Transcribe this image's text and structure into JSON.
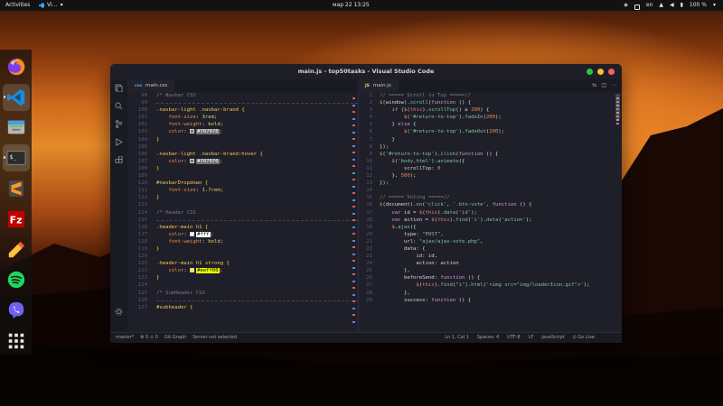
{
  "topbar": {
    "activities": "Activities",
    "app_name": "Vi…",
    "clock": "мар 22  13:25",
    "lang": "en",
    "battery": "100 %"
  },
  "dock": {
    "items": [
      {
        "name": "firefox-icon",
        "active": false
      },
      {
        "name": "vscode-icon",
        "active": true
      },
      {
        "name": "files-icon",
        "active": false
      },
      {
        "name": "terminal-icon",
        "active": true
      },
      {
        "name": "sublime-text-icon",
        "active": false
      },
      {
        "name": "filezilla-icon",
        "active": false
      },
      {
        "name": "color-picker-icon",
        "active": false
      },
      {
        "name": "spotify-icon",
        "active": false
      },
      {
        "name": "viber-icon",
        "active": false
      },
      {
        "name": "show-apps-icon",
        "active": false
      }
    ]
  },
  "window": {
    "title": "main.js - top50tasks - Visual Studio Code",
    "left_tab": "main.css",
    "right_tab": "main.js",
    "left_tab_icon": "css",
    "right_tab_icon": "JS"
  },
  "left_editor": {
    "lines": [
      {
        "n": "98",
        "html": "<span class='t-cm'>/* Navbar CSS</span>",
        "sep": false
      },
      {
        "n": "99",
        "html": "",
        "sep": true
      },
      {
        "n": "100",
        "html": "<span class='t-sel'>.navbar-light .navbar-brand</span> <span class='t-br'>{</span>"
      },
      {
        "n": "101",
        "html": "    <span class='t-prop'>font-size</span><span class='t-pl'>: </span><span class='t-val'>3rem</span><span class='t-pl'>;</span>"
      },
      {
        "n": "102",
        "html": "    <span class='t-prop'>font-weight</span><span class='t-pl'>: </span><span class='t-val'>bold</span><span class='t-pl'>;</span>"
      },
      {
        "n": "103",
        "html": "    <span class='t-prop'>color</span><span class='t-pl'>: </span><span class='swatch' style='background:#707070'></span><span class='hl' style='background:#707070;color:#fff'>#707070</span><span class='t-pl'>;</span>"
      },
      {
        "n": "104",
        "html": "<span class='t-br'>}</span>"
      },
      {
        "n": "105",
        "html": ""
      },
      {
        "n": "106",
        "html": "<span class='t-sel'>.navbar-light .navbar-brand:hover</span> <span class='t-br'>{</span>"
      },
      {
        "n": "107",
        "html": "    <span class='t-prop'>color</span><span class='t-pl'>: </span><span class='swatch' style='background:#707070'></span><span class='hl' style='background:#707070;color:#fff'>#707070</span><span class='t-pl'>;</span>"
      },
      {
        "n": "108",
        "html": "<span class='t-br'>}</span>"
      },
      {
        "n": "109",
        "html": ""
      },
      {
        "n": "110",
        "html": "<span class='t-sel'>#navbarDropdown</span> <span class='t-br'>{</span>"
      },
      {
        "n": "111",
        "html": "    <span class='t-prop'>font-size</span><span class='t-pl'>: </span><span class='t-val'>1.7rem</span><span class='t-pl'>;</span>"
      },
      {
        "n": "112",
        "html": "<span class='t-br'>}</span>"
      },
      {
        "n": "113",
        "html": ""
      },
      {
        "n": "114",
        "html": "<span class='t-cm'>/* Header CSS</span>"
      },
      {
        "n": "115",
        "html": "",
        "sep": true
      },
      {
        "n": "116",
        "html": "<span class='t-sel'>.header-main h1</span> <span class='t-br'>{</span>"
      },
      {
        "n": "117",
        "html": "    <span class='t-prop'>color</span><span class='t-pl'>: </span><span class='swatch' style='background:#fff'></span><span class='hl' style='background:#ffffff;color:#000'>#fff</span><span class='t-pl'>;</span>"
      },
      {
        "n": "118",
        "html": "    <span class='t-prop'>font-weight</span><span class='t-pl'>: </span><span class='t-val'>bold</span><span class='t-pl'>;</span>"
      },
      {
        "n": "119",
        "html": "<span class='t-br'>}</span>"
      },
      {
        "n": "120",
        "html": ""
      },
      {
        "n": "121",
        "html": "<span class='t-sel'>.header-main h1 strong</span> <span class='t-br'>{</span>"
      },
      {
        "n": "122",
        "html": "    <span class='t-prop'>color</span><span class='t-pl'>: </span><span class='swatch' style='background:#eeff00'></span><span class='hl' style='background:#eeff00;color:#000'>#eeff00</span><span class='t-pl'>;</span>"
      },
      {
        "n": "123",
        "html": "<span class='t-br'>}</span>"
      },
      {
        "n": "124",
        "html": ""
      },
      {
        "n": "125",
        "html": "<span class='t-cm'>/* SubHeader CSS</span>"
      },
      {
        "n": "126",
        "html": "",
        "sep": true
      },
      {
        "n": "127",
        "html": "<span class='t-sel'>#subheader</span> <span class='t-br'>{</span>"
      }
    ]
  },
  "right_editor": {
    "lines": [
      {
        "n": "1",
        "html": "<span class='t-cm'>// ===== Scroll to Top =====//</span>"
      },
      {
        "n": "2",
        "html": "<span class='t-jq'>$</span><span class='t-pl'>(window).</span><span class='t-fn'>scroll</span><span class='t-pl'>(</span><span class='t-kw'>function</span><span class='t-pl'> () {</span>"
      },
      {
        "n": "3",
        "html": "    <span class='t-kw'>if</span><span class='t-pl'> (</span><span class='t-jq'>$</span><span class='t-pl'>(</span><span class='t-var'>this</span><span class='t-pl'>).</span><span class='t-fn'>scrollTop</span><span class='t-pl'>() ≥ </span><span class='t-num'>200</span><span class='t-pl'>) {</span>"
      },
      {
        "n": "4",
        "html": "        <span class='t-jq'>$</span><span class='t-pl'>(</span><span class='t-str'>'#return-to-top'</span><span class='t-pl'>).</span><span class='t-fn'>fadeIn</span><span class='t-pl'>(</span><span class='t-num'>200</span><span class='t-pl'>);</span>"
      },
      {
        "n": "5",
        "html": "    <span class='t-pl'>} </span><span class='t-kw'>else</span><span class='t-pl'> {</span>"
      },
      {
        "n": "6",
        "html": "        <span class='t-jq'>$</span><span class='t-pl'>(</span><span class='t-str'>'#return-to-top'</span><span class='t-pl'>).</span><span class='t-fn'>fadeOut</span><span class='t-pl'>(</span><span class='t-num'>200</span><span class='t-pl'>);</span>"
      },
      {
        "n": "7",
        "html": "    <span class='t-pl'>}</span>"
      },
      {
        "n": "8",
        "html": "<span class='t-pl'>});</span>"
      },
      {
        "n": "9",
        "html": "<span class='t-jq'>$</span><span class='t-pl'>(</span><span class='t-str'>'#return-to-top'</span><span class='t-pl'>).</span><span class='t-fn'>click</span><span class='t-pl'>(</span><span class='t-kw'>function</span><span class='t-pl'> () {</span>"
      },
      {
        "n": "10",
        "html": "    <span class='t-jq'>$</span><span class='t-pl'>(</span><span class='t-str'>'body,html'</span><span class='t-pl'>).</span><span class='t-fn'>animate</span><span class='t-pl'>({</span>"
      },
      {
        "n": "11",
        "html": "        <span class='t-pl'>scrollTop: </span><span class='t-num'>0</span>"
      },
      {
        "n": "12",
        "html": "    <span class='t-pl'>}, </span><span class='t-num'>500</span><span class='t-pl'>);</span>"
      },
      {
        "n": "13",
        "html": "<span class='t-pl'>});</span>"
      },
      {
        "n": "14",
        "html": ""
      },
      {
        "n": "15",
        "html": "<span class='t-cm'>// ===== Voting =====//</span>"
      },
      {
        "n": "16",
        "html": "<span class='t-jq'>$</span><span class='t-pl'>(document).</span><span class='t-fn'>on</span><span class='t-pl'>(</span><span class='t-str'>'click'</span><span class='t-pl'>, </span><span class='t-str'>'.btn-vote'</span><span class='t-pl'>, </span><span class='t-kw'>function</span><span class='t-pl'> () {</span>"
      },
      {
        "n": "17",
        "html": "    <span class='t-kw'>var</span><span class='t-pl'> id = </span><span class='t-jq'>$</span><span class='t-pl'>(</span><span class='t-var'>this</span><span class='t-pl'>).</span><span class='t-fn'>data</span><span class='t-pl'>(</span><span class='t-str'>'id'</span><span class='t-pl'>);</span>"
      },
      {
        "n": "18",
        "html": "    <span class='t-kw'>var</span><span class='t-pl'> action = </span><span class='t-jq'>$</span><span class='t-pl'>(</span><span class='t-var'>this</span><span class='t-pl'>).</span><span class='t-fn'>find</span><span class='t-pl'>(</span><span class='t-str'>'i'</span><span class='t-pl'>).</span><span class='t-fn'>data</span><span class='t-pl'>(</span><span class='t-str'>'action'</span><span class='t-pl'>);</span>"
      },
      {
        "n": "19",
        "html": "    <span class='t-jq'>$</span><span class='t-pl'>.</span><span class='t-fn'>ajax</span><span class='t-pl'>({</span>"
      },
      {
        "n": "20",
        "html": "        <span class='t-pl'>type: </span><span class='t-str'>\"POST\"</span><span class='t-pl'>,</span>"
      },
      {
        "n": "21",
        "html": "        <span class='t-pl'>url: </span><span class='t-str'>\"ajax/ajax-vote.php\"</span><span class='t-pl'>,</span>"
      },
      {
        "n": "22",
        "html": "        <span class='t-pl'>data: {</span>"
      },
      {
        "n": "23",
        "html": "            <span class='t-pl'>id: id,</span>"
      },
      {
        "n": "24",
        "html": "            <span class='t-pl'>action: action</span>"
      },
      {
        "n": "25",
        "html": "        <span class='t-pl'>},</span>"
      },
      {
        "n": "26",
        "html": "        <span class='t-pl'>beforeSend: </span><span class='t-kw'>function</span><span class='t-pl'> () {</span>"
      },
      {
        "n": "27",
        "html": "            <span class='t-jq'>$</span><span class='t-pl'>(</span><span class='t-var'>this</span><span class='t-pl'>).</span><span class='t-fn'>find</span><span class='t-pl'>(</span><span class='t-str'>\"i\"</span><span class='t-pl'>).</span><span class='t-fn'>html</span><span class='t-pl'>(</span><span class='t-str'>'&lt;img src=\"img/loaderIcon.gif\"&gt;'</span><span class='t-pl'>);</span>"
      },
      {
        "n": "28",
        "html": "        <span class='t-pl'>},</span>"
      },
      {
        "n": "29",
        "html": "        <span class='t-pl'>success: </span><span class='t-kw'>function</span><span class='t-pl'> () {</span>"
      }
    ]
  },
  "statusbar": {
    "branch": "master*",
    "errors": "⊗ 0 ⚠ 0",
    "git_graph": "Git Graph",
    "server": "Server not selected",
    "position": "Ln 1, Col 1",
    "spaces": "Spaces: 4",
    "encoding": "UTF-8",
    "eol": "LF",
    "language": "JavaScript",
    "go_live": "⊙ Go Live"
  },
  "colors": {
    "window_bg": "#1f1f29",
    "comment": "#7a7a8e",
    "selector": "#f8c555",
    "keyword": "#cc99cd",
    "function": "#7ec699"
  }
}
